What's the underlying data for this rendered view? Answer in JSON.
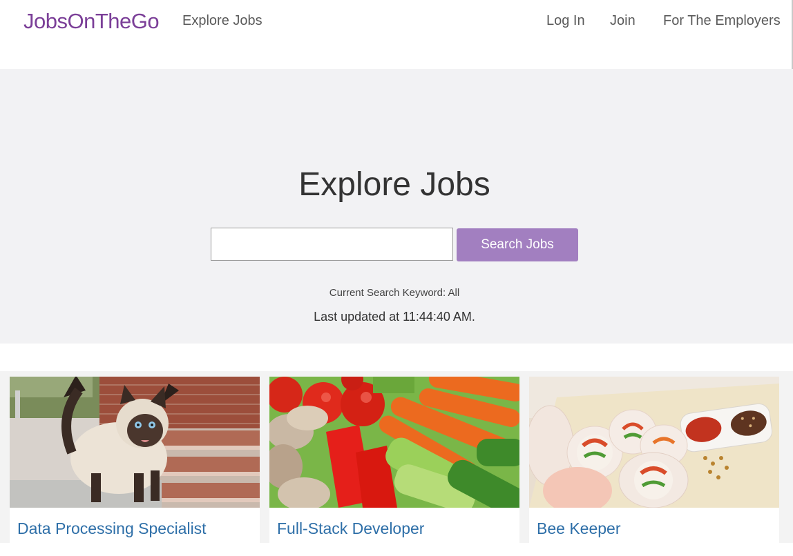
{
  "nav": {
    "brand": "JobsOnTheGo",
    "explore": "Explore Jobs",
    "login": "Log In",
    "join": "Join",
    "employers": "For The Employers"
  },
  "hero": {
    "title": "Explore Jobs",
    "search_value": "",
    "search_placeholder": "",
    "search_button": "Search Jobs",
    "keyword_text": "Current Search Keyword: All",
    "updated_text": "Last updated at 11:44:40 AM."
  },
  "jobs": [
    {
      "title": "Data Processing Specialist",
      "image": "siamese-cat-photo"
    },
    {
      "title": "Full-Stack Developer",
      "image": "vegetables-photo"
    },
    {
      "title": "Bee Keeper",
      "image": "spring-rolls-photo"
    }
  ],
  "colors": {
    "brand": "#7b3f98",
    "button": "#a27fc0",
    "job_title": "#2e6fa8",
    "hero_bg": "#f2f2f4"
  }
}
